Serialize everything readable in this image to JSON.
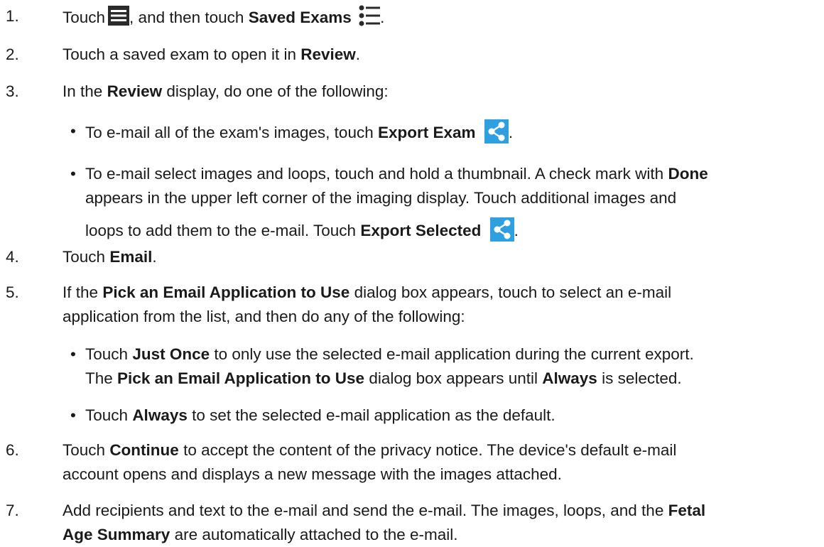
{
  "steps": [
    {
      "num": "1.",
      "t1": "Touch",
      "t2": ", and then touch",
      "b1": "Saved Exams",
      "t3": "."
    },
    {
      "num": "2.",
      "t1": "Touch a saved exam to open it in",
      "b1": "Review",
      "t2": "."
    },
    {
      "num": "3.",
      "t1": "In the",
      "b1": "Review",
      "t2": "display, do one of the following:",
      "bullets": [
        {
          "dot": "•",
          "t1": "To e-mail all of the exam's images, touch",
          "b1": "Export Exam",
          "t2": "."
        },
        {
          "dot": "•",
          "l1_t1": "To e-mail select images and loops, touch and hold a thumbnail. A check mark with",
          "l1_b1": "Done",
          "l2": "appears in the upper left corner of the imaging display. Touch additional images and",
          "l3_t1": "loops to add them to the e-mail. Touch",
          "l3_b1": "Export Selected",
          "l3_t2": "."
        }
      ]
    },
    {
      "num": "4.",
      "t1": "Touch",
      "b1": "Email",
      "t2": "."
    },
    {
      "num": "5.",
      "l1_t1": "If the",
      "l1_b1": "Pick an Email Application to Use",
      "l1_t2": "dialog box appears, touch to select an e-mail",
      "l2": "application from the list, and then do any of the following:",
      "bullets": [
        {
          "dot": "•",
          "l1_t1": "Touch",
          "l1_b1": "Just Once",
          "l1_t2": "to only use the selected e-mail application during the current export.",
          "l2_t1": "The",
          "l2_b1": "Pick an Email Application to Use",
          "l2_t2": "dialog box appears until",
          "l2_b2": "Always",
          "l2_t3": "is selected."
        },
        {
          "dot": "•",
          "t1": "Touch",
          "b1": "Always",
          "t2": "to set the selected e-mail application as the default."
        }
      ]
    },
    {
      "num": "6.",
      "l1_t1": "Touch",
      "l1_b1": "Continue",
      "l1_t2": "to accept the content of the privacy notice. The device's default e-mail",
      "l2": "account opens and displays a new message with the images attached."
    },
    {
      "num": "7.",
      "l1": "Add recipients and text to the e-mail and send the e-mail. The images, loops, and the",
      "l1_b1": "Fetal",
      "l2_b1": "Age Summary",
      "l2_t1": "are automatically attached to the e-mail."
    }
  ],
  "icons": {
    "menu": "menu-icon",
    "saved_exams": "list-icon",
    "export_exam": "share-icon",
    "export_selected": "share-icon"
  },
  "colors": {
    "text": "#1a1a1a",
    "icon_dark": "#2b2b2b",
    "share_bg": "#2e9fe0",
    "share_fg": "#ffffff"
  }
}
